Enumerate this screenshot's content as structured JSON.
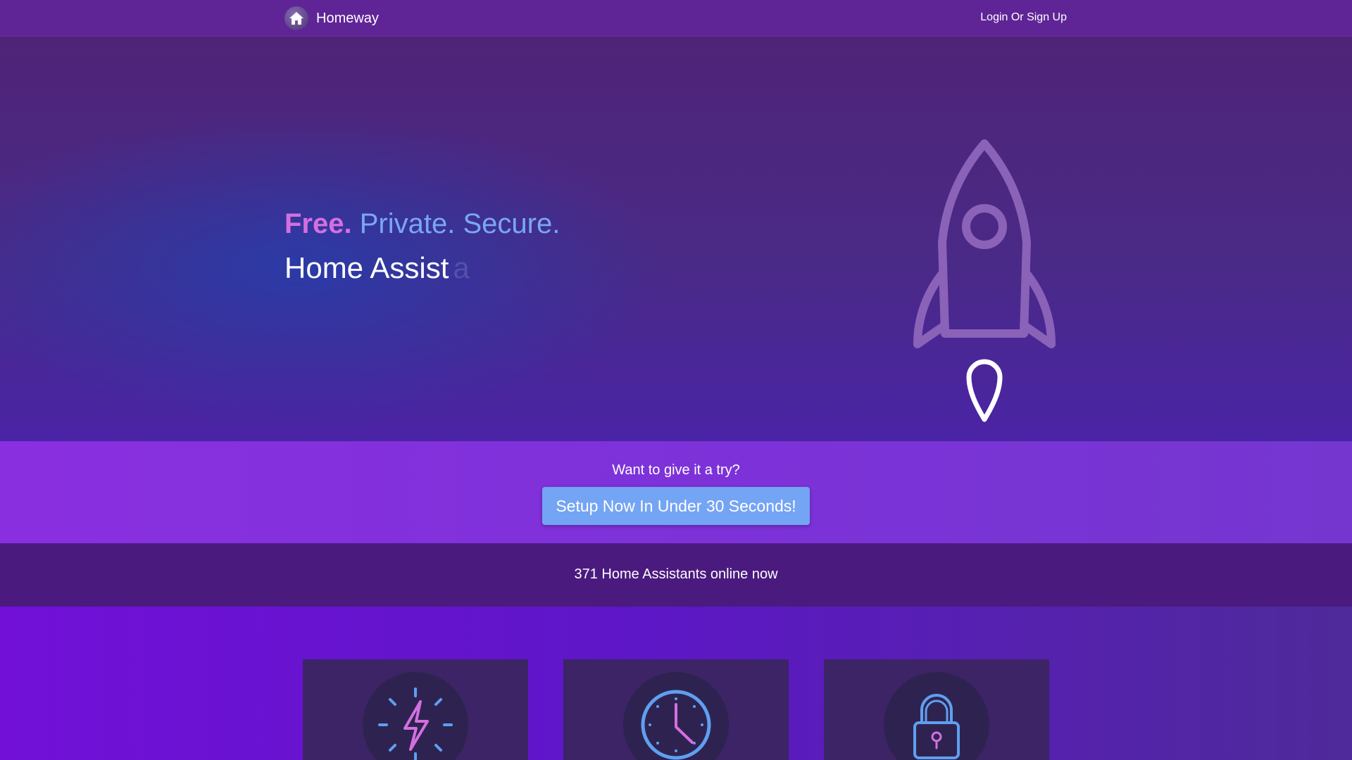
{
  "header": {
    "brand_name": "Homeway",
    "login_label": "Login Or Sign Up"
  },
  "hero": {
    "tagline_free": "Free.",
    "tagline_rest": "Private. Secure.",
    "typed_text": "Home Assist",
    "typed_ghost": "a"
  },
  "cta": {
    "question": "Want to give it a try?",
    "button_label": "Setup Now In Under 30 Seconds!"
  },
  "status": {
    "online_text": "371 Home Assistants online now"
  },
  "features": {
    "icons": [
      "lightning-icon",
      "clock-icon",
      "lock-icon"
    ]
  },
  "colors": {
    "accent_pink": "#d46fe0",
    "accent_blue": "#74a4f4",
    "header_bg": "#5f2596"
  }
}
